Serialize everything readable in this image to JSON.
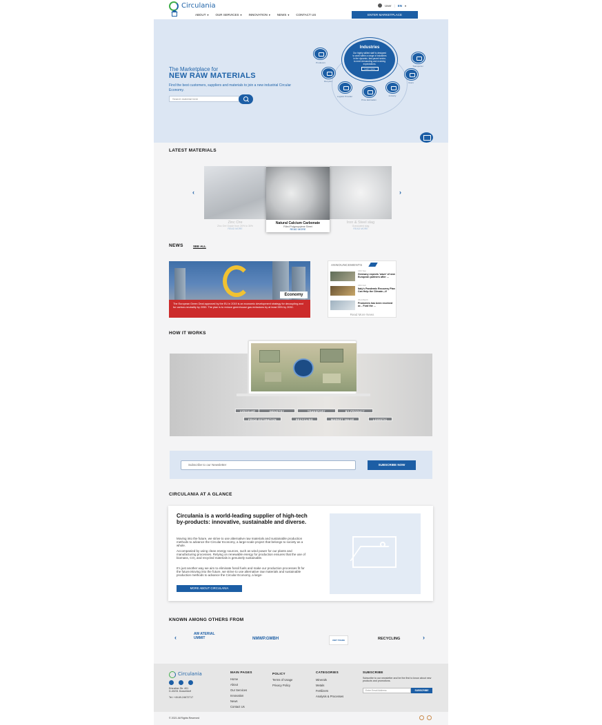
{
  "header": {
    "logo_text": "Circulania",
    "user_label": "User",
    "lang": "EN",
    "nav": [
      {
        "label": "ABOUT",
        "has_dropdown": true
      },
      {
        "label": "OUR SERVICES",
        "has_dropdown": true
      },
      {
        "label": "INNOVATION",
        "has_dropdown": true
      },
      {
        "label": "NEWS",
        "has_dropdown": true
      },
      {
        "label": "CONTACT US",
        "has_dropdown": false
      }
    ],
    "cta_label": "ENTER MARKETPLACE"
  },
  "hero": {
    "subtitle": "The Marketplace for",
    "title": "NEW RAW MATERIALS",
    "description": "Find the best customers, suppliers and materials to join a new industrial Circular Economy.",
    "search_placeholder": "Search material here",
    "industries": {
      "title": "Industries",
      "text": "Our highly skilled staff is designed to work within a range of industries in the dynamic, fast-paced sector, to meet demanding and evolving expectations.",
      "button": "Learn more"
    },
    "icons": [
      {
        "name": "producers-icon",
        "label": "Producers"
      },
      {
        "name": "transporter-icon",
        "label": "Transporter"
      },
      {
        "name": "recycler-icon",
        "label": "Recycler"
      },
      {
        "name": "users-icon",
        "label": "Users"
      },
      {
        "name": "logistic-icon",
        "label": "Logistic Provider"
      },
      {
        "name": "price-estimation-icon",
        "label": "Price Estimation"
      },
      {
        "name": "industry-icon",
        "label": "Industry"
      }
    ]
  },
  "latest_materials": {
    "title": "LATEST MATERIALS",
    "items": [
      {
        "name": "Zinc Ore",
        "desc": "Zinc Ore Grade from 20% to 30%",
        "link": "READ MORE"
      },
      {
        "name": "Natural Calcium Carbonate",
        "desc": "Filled Polypropylene Sheet",
        "link": "READ MORE"
      },
      {
        "name": "Iron & Steel slag",
        "desc": "Granulated slag",
        "link": "READ MORE"
      }
    ]
  },
  "news": {
    "title": "NEWS",
    "see_all": "SEE ALL",
    "feature": {
      "tag": "Economy",
      "caption": "The European Green Deal approved by the EU in 2019 is an economic development strategy for decoupling and for carbon-neutrality by 2050. The plan is to reduce greenhouse gas emissions by at least 55% by 2030."
    },
    "announcements": {
      "title": "ANNOUNCEMENTS",
      "items": [
        {
          "date": "16th Sep",
          "title": "Germany expects 'wave' of new European partners after ..."
        },
        {
          "date": "16th Feb",
          "title": "Italy's Pandemic Recovery Plan Can Help the Climate—If"
        },
        {
          "date": "21st March",
          "title": "Promoters has been received or... Ford the ..."
        }
      ],
      "more": "Read More News"
    }
  },
  "how_it_works": {
    "title": "HOW IT WORKS",
    "tags_row1": [
      "CIRCULAR",
      "INDUSTRY",
      "TRANSPORT",
      "BY-PRODUCT"
    ],
    "tags_row2": [
      "PRICE ESTIMATION",
      "RECYCLING",
      "MARKET VALUE",
      "LOGISTIC"
    ]
  },
  "newsletter": {
    "placeholder": "Subscribe to our Newsletter",
    "button": "SUBSCRIBE NOW"
  },
  "glance": {
    "title": "CIRCULANIA AT A GLANCE",
    "heading": "Circulania is a world-leading supplier of high-tech by-products: innovative, sustainable and diverse.",
    "p1": "Moving into the future, we strive to use alternative raw materials and sustainable production methods to advance the Circular Economy, a large-scale project that belongs to society as a whole.",
    "p2": "Accompanied by using clean energy sources, such as wind power for our plants and manufacturing processes. Relying on renewable energy for production ensures that the use of biomass, CO₂ and recycled materials is genuinely sustainable.",
    "p3": "It's just another way we aim to eliminate fossil fuels and make our production processes fit for the future.Moving into the future, we strive to use alternative raw materials and sustainable production methods to advance the Circular Economy, a large-",
    "button": "MORE ABOUT CIRCULANIA"
  },
  "partners": {
    "title": "KNOWN AMONG OTHERS FROM",
    "logos": [
      "AW ATERIAL UMMIT",
      "NMWP.GMBH",
      "UNIT TRADE",
      "RECYCLING"
    ]
  },
  "footer": {
    "logo_text": "Circulania",
    "address": [
      "Erkrather Str. 401",
      "D-40231 Dusseldorf",
      "",
      "Tel: +49-69-24672717"
    ],
    "columns": [
      {
        "heading": "MAIN PAGES",
        "items": [
          "Home",
          "About",
          "Our Services",
          "Innovation",
          "News",
          "Contact Us"
        ]
      },
      {
        "heading": "POLICY",
        "items": [
          "Terms of Usage",
          "Privacy Policy"
        ]
      },
      {
        "heading": "CATEGORIES",
        "items": [
          "Minerals",
          "Metals",
          "Fertilizers",
          "Analysis & Processes"
        ]
      }
    ],
    "subscribe": {
      "heading": "SUBSCRIBE",
      "text": "Subscribe to our newsletter and be the first to know about new products and promotions.",
      "placeholder": "Enter Email Address",
      "button": "SUBSCRIBE"
    },
    "copyright": "© 2021 All Rights Reserved"
  },
  "colors": {
    "brand_blue": "#1c5ea5",
    "brand_green": "#3fae49",
    "hero_bg": "#dce6f3"
  }
}
